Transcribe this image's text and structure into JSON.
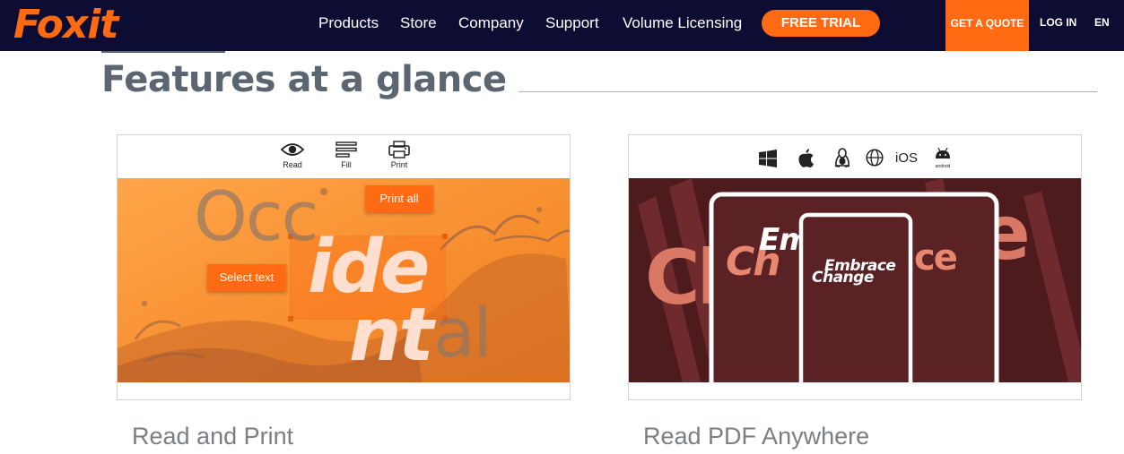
{
  "nav": {
    "logo": "Foxit",
    "links": [
      "Products",
      "Store",
      "Company",
      "Support",
      "Volume Licensing"
    ],
    "free_trial": "FREE TRIAL",
    "get_quote": "GET A QUOTE",
    "login": "LOG IN",
    "language": "EN"
  },
  "section": {
    "title": "Features at a glance"
  },
  "cards": [
    {
      "caption": "Read and Print",
      "tools": [
        {
          "label": "Read",
          "icon": "eye-icon"
        },
        {
          "label": "Fill",
          "icon": "fill-lines-icon"
        },
        {
          "label": "Print",
          "icon": "printer-icon"
        }
      ],
      "art": {
        "word_faded_top": "Occ",
        "word_bold_top": "ide",
        "word_bold_bottom": "nt",
        "word_faded_bottom": "al",
        "tooltip_select": "Select text",
        "tooltip_print": "Print all"
      }
    },
    {
      "caption": "Read PDF Anywhere",
      "platforms": [
        {
          "icon": "windows-icon"
        },
        {
          "icon": "apple-icon"
        },
        {
          "icon": "linux-icon"
        },
        {
          "icon": "globe-icon"
        },
        {
          "label": "iOS",
          "icon": "ios-icon"
        },
        {
          "label": "android",
          "icon": "android-icon"
        }
      ],
      "art": {
        "line1": "Embrace",
        "line2": "Change"
      }
    }
  ],
  "colors": {
    "nav_bg": "#0d0d33",
    "accent": "#ff6a13",
    "heading": "#5b6670",
    "art_orange": "#ff9a3c",
    "art_maroon": "#4d1a1d",
    "salmon": "#e07a66"
  }
}
